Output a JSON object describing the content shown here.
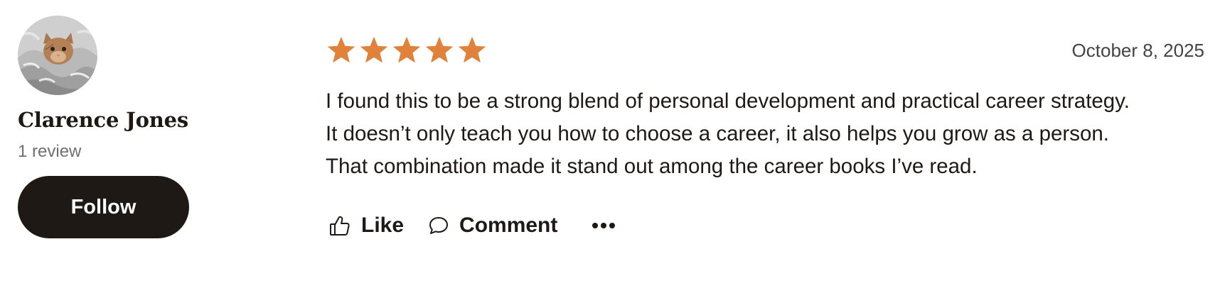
{
  "reviewer": {
    "name": "Clarence Jones",
    "review_count": "1 review",
    "follow_label": "Follow",
    "avatar": "cat-in-blanket-avatar"
  },
  "review": {
    "rating": 5,
    "max_rating": 5,
    "star_color": "#e0823a",
    "date": "October 8, 2025",
    "text_lines": [
      "I found this to be a strong blend of personal development and practical career strategy.",
      "It doesn’t only teach you how to choose a career, it also helps you grow as a person.",
      "That combination made it stand out among the career books I’ve read."
    ]
  },
  "actions": {
    "like_label": "Like",
    "like_icon": "thumbs-up-icon",
    "comment_label": "Comment",
    "comment_icon": "speech-bubble-icon",
    "more_icon": "more-horizontal-icon"
  },
  "colors": {
    "text": "#1e1915",
    "muted": "#707070",
    "button_bg": "#1e1915",
    "button_text": "#ffffff"
  }
}
